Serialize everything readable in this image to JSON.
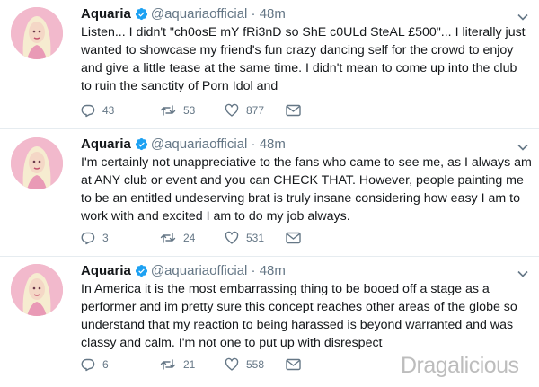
{
  "tweets": [
    {
      "name": "Aquaria",
      "handle": "@aquariaofficial",
      "separator": "·",
      "time": "48m",
      "lines": [
        "Listen... I didn't \"ch0osE mY fRi3nD so ShE c0ULd SteAL £500\"... I literally just",
        "wanted to showcase my friend's fun crazy dancing self for the crowd to enjoy",
        "and give a little tease at the same time. I didn't mean to come up into the club",
        "to ruin the sanctity of Porn Idol and"
      ],
      "replies": "43",
      "retweets": "53",
      "likes": "877"
    },
    {
      "name": "Aquaria",
      "handle": "@aquariaofficial",
      "separator": "·",
      "time": "48m",
      "lines": [
        "I'm certainly not unappreciative to the fans who came to see me, as I always am",
        "at ANY club or event and you can CHECK THAT. However, people painting me",
        "to be an entitled undeserving brat is truly insane considering how easy I am to",
        "work with and excited I am to do my job always."
      ],
      "replies": "3",
      "retweets": "24",
      "likes": "531"
    },
    {
      "name": "Aquaria",
      "handle": "@aquariaofficial",
      "separator": "·",
      "time": "48m",
      "lines": [
        "In America it is the most embarrassing thing to be booed off a stage as a",
        "performer and im pretty sure this concept reaches other areas of the globe so",
        "understand that my reaction to being harassed is beyond warranted and was",
        "classy and calm. I'm not one to put up with disrespect"
      ],
      "replies": "6",
      "retweets": "21",
      "likes": "558"
    }
  ],
  "colors": {
    "text": "#14171a",
    "muted": "#657786",
    "verified": "#1da1f2",
    "divider": "#e6ecf0"
  },
  "icons": [
    "verified-badge-icon",
    "chevron-down-icon",
    "reply-icon",
    "retweet-icon",
    "like-icon",
    "direct-message-icon"
  ],
  "watermark": "Dragalicious"
}
